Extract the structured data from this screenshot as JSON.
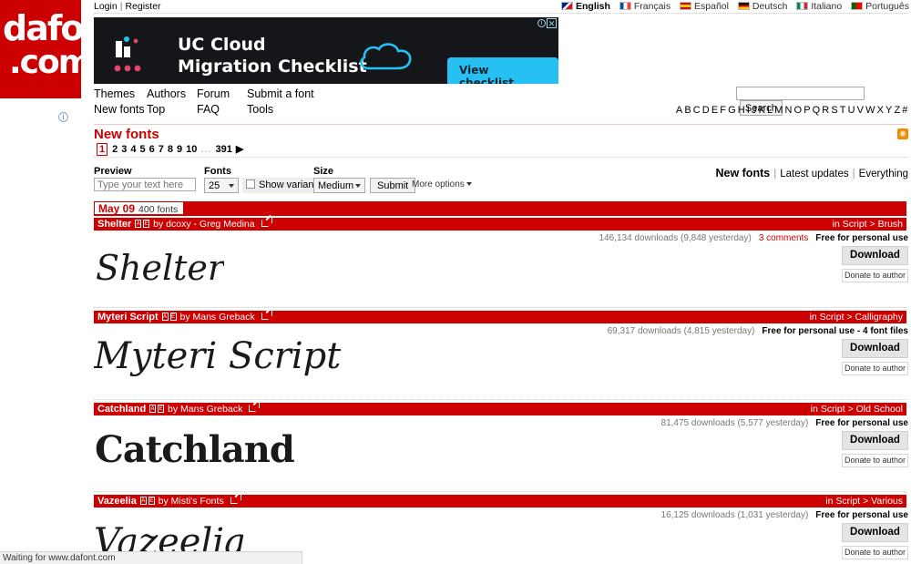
{
  "site": {
    "logo_line1": "dafont",
    "logo_line2": ".com",
    "info_icon": "info-icon"
  },
  "topbar": {
    "login": "Login",
    "separator": "|",
    "register": "Register",
    "languages": [
      {
        "label": "English",
        "flag1": "#00247d",
        "flag2": "#cf142b",
        "active": true
      },
      {
        "label": "Français",
        "flag1": "#ffffff",
        "flag2": "#0055a4",
        "active": false
      },
      {
        "label": "Español",
        "flag1": "#ffc400",
        "flag2": "#c60b1e",
        "active": false
      },
      {
        "label": "Deutsch",
        "flag1": "#dd0000",
        "flag2": "#111111",
        "active": false
      },
      {
        "label": "Italiano",
        "flag1": "#009246",
        "flag2": "#ce2b37",
        "active": false
      },
      {
        "label": "Português",
        "flag1": "#ff0000",
        "flag2": "#006600",
        "active": false
      }
    ]
  },
  "ad": {
    "line1": "UC Cloud",
    "line2": "Migration Checklist",
    "cta": "View checklist",
    "info_icon": "ad-info-icon",
    "close_icon": "ad-close-icon",
    "accent": "#27c0f2",
    "background": "#141619"
  },
  "nav": {
    "row1": [
      "Themes",
      "Authors",
      "Forum",
      "Submit a font"
    ],
    "row2": [
      "New fonts",
      "Top",
      "FAQ",
      "Tools"
    ]
  },
  "search": {
    "value": "",
    "placeholder": "",
    "button": "Search"
  },
  "alphabet": [
    "A",
    "B",
    "C",
    "D",
    "E",
    "F",
    "G",
    "H",
    "I",
    "J",
    "K",
    "L",
    "M",
    "N",
    "O",
    "P",
    "Q",
    "R",
    "S",
    "T",
    "U",
    "V",
    "W",
    "X",
    "Y",
    "Z",
    "#"
  ],
  "page": {
    "title": "New fonts",
    "rss_icon": "rss-icon"
  },
  "pagination": {
    "current": "1",
    "pages": [
      "2",
      "3",
      "4",
      "5",
      "6",
      "7",
      "8",
      "9",
      "10"
    ],
    "ellipsis": "...",
    "last": "391",
    "next_icon": "next-page-icon"
  },
  "controls": {
    "preview_label": "Preview",
    "preview_placeholder": "Type your text here",
    "preview_value": "",
    "fonts_label": "Fonts",
    "fonts_value": "25",
    "show_variants_label": "Show variants",
    "show_variants_checked": false,
    "size_label": "Size",
    "size_value": "Medium",
    "submit_label": "Submit",
    "more_options_label": "More options"
  },
  "viewnav": {
    "active": "New fonts",
    "sep": "|",
    "latest": "Latest updates",
    "everything": "Everything"
  },
  "day_header": {
    "date": "May 09",
    "count": "400 fonts"
  },
  "fonts": [
    {
      "name": "Shelter",
      "by": "by dcoxy - Greg Medina",
      "category": "in Script > Brush",
      "downloads": "146,134 downloads (9,848 yesterday)",
      "comments": "3 comments",
      "license": "Free for personal use",
      "download_label": "Download",
      "donate_label": "Donate to author",
      "sample": "Shelter"
    },
    {
      "name": "Myteri Script",
      "by": "by Mans Greback",
      "category": "in Script > Calligraphy",
      "downloads": "69,317 downloads (4,815 yesterday)",
      "comments": "",
      "license": "Free for personal use - 4 font files",
      "download_label": "Download",
      "donate_label": "Donate to author",
      "sample": "Myteri Script"
    },
    {
      "name": "Catchland",
      "by": "by Mans Greback",
      "category": "in Script > Old School",
      "downloads": "81,475 downloads (5,577 yesterday)",
      "comments": "",
      "license": "Free for personal use",
      "download_label": "Download",
      "donate_label": "Donate to author",
      "sample": "Catchland"
    },
    {
      "name": "Vazeelia",
      "by": "by Misti's Fonts",
      "category": "in Script > Various",
      "downloads": "16,125 downloads (1,031 yesterday)",
      "comments": "",
      "license": "Free for personal use",
      "download_label": "Download",
      "donate_label": "Donate to author",
      "sample": "Vazeelia"
    }
  ],
  "font_badges": {
    "a": "A",
    "b": "E"
  },
  "statusbar": {
    "text": "Waiting for www.dafont.com"
  },
  "colors": {
    "brand_red": "#cc0000",
    "link_black": "#000000",
    "muted": "#777777"
  }
}
